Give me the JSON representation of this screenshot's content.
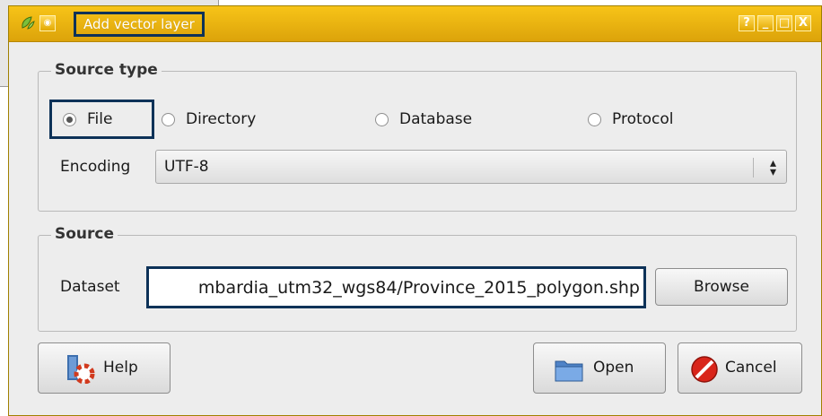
{
  "window": {
    "title": "Add vector layer",
    "controls": {
      "help": "?",
      "minimize": "_",
      "maximize": "□",
      "close": "X"
    }
  },
  "source_type": {
    "legend": "Source type",
    "options": [
      {
        "label": "File",
        "checked": true
      },
      {
        "label": "Directory",
        "checked": false
      },
      {
        "label": "Database",
        "checked": false
      },
      {
        "label": "Protocol",
        "checked": false
      }
    ],
    "encoding_label": "Encoding",
    "encoding_value": "UTF-8"
  },
  "source": {
    "legend": "Source",
    "dataset_label": "Dataset",
    "dataset_value": "mbardia_utm32_wgs84/Province_2015_polygon.shp",
    "browse_label": "Browse"
  },
  "buttons": {
    "help_label": "Help",
    "open_label": "Open",
    "cancel_label": "Cancel"
  },
  "icons": {
    "app": "qgis-icon",
    "help": "help-lifebuoy-icon",
    "open": "folder-icon",
    "cancel": "stop-icon"
  },
  "colors": {
    "titlebar": "#e9b210",
    "highlight_border": "#0d3258",
    "dialog_bg": "#ededed"
  }
}
